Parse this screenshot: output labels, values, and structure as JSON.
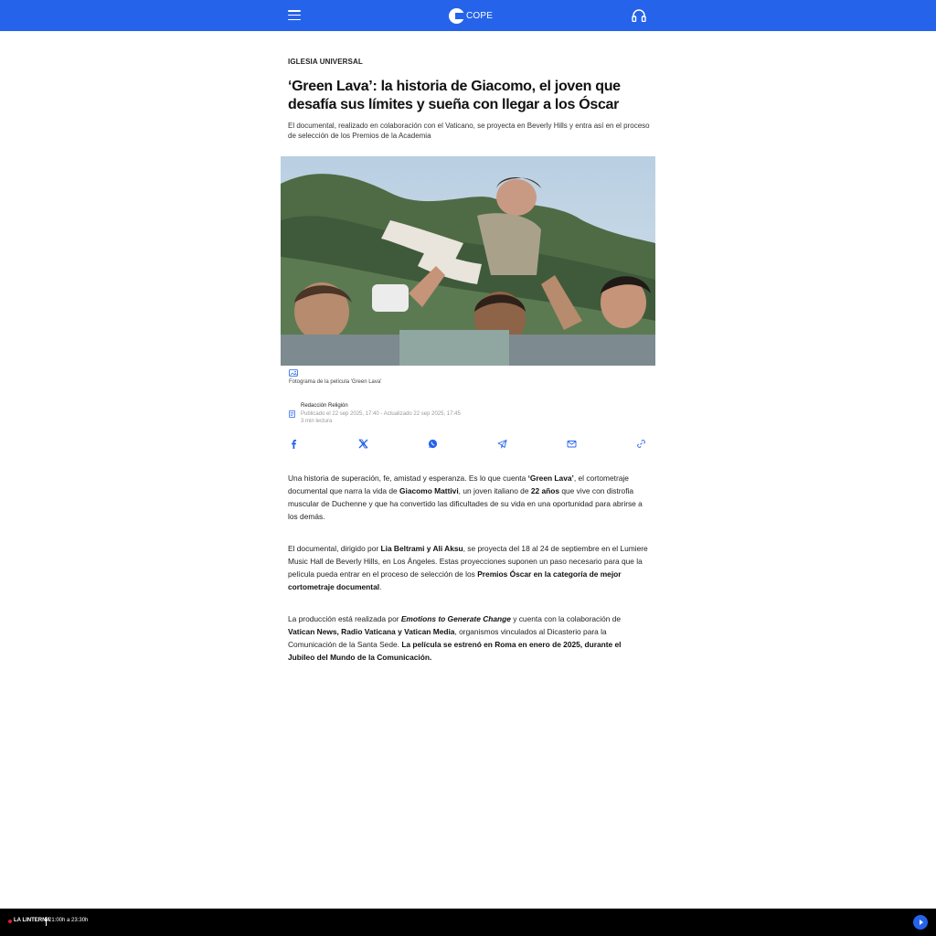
{
  "header": {
    "logo_text": "COPE",
    "menu_icon": "hamburger-menu-icon",
    "listen_icon": "headphones-icon",
    "brand_color": "#2563eb"
  },
  "article": {
    "section": "IGLESIA UNIVERSAL",
    "headline": "‘Green Lava’: la historia de Giacomo, el joven que desafía sus límites y sueña con llegar a los Óscar",
    "subtitle": "El documental, realizado en colaboración con el Vaticano, se proyecta en Beverly Hills y entra así en el proceso de selección de los Premios de la Academia",
    "image_caption": "Fotograma de la película 'Green Lava'",
    "author": "Redacción Religión",
    "dates": "Publicado el 22 sep 2025, 17:40 - Actualizado 22 sep 2025, 17:45",
    "read_time": "3 min lectura"
  },
  "share": {
    "icons": [
      "facebook-icon",
      "x-icon",
      "whatsapp-icon",
      "telegram-icon",
      "email-icon",
      "link-icon"
    ]
  },
  "body": {
    "p1": [
      {
        "t": "Una historia de superación, fe, amistad y esperanza. Es lo que cuenta ",
        "b": false
      },
      {
        "t": "‘Green Lava’",
        "b": true
      },
      {
        "t": ", el cortometraje documental que narra la vida de ",
        "b": false
      },
      {
        "t": "Giacomo Mattivi",
        "b": true
      },
      {
        "t": ", un joven italiano de ",
        "b": false
      },
      {
        "t": "22 años",
        "b": true
      },
      {
        "t": " que vive con distrofia muscular de Duchenne y que ha convertido las dificultades de su vida en una oportunidad para abrirse a los demás.",
        "b": false
      }
    ],
    "p2": [
      {
        "t": "El documental, dirigido por ",
        "b": false
      },
      {
        "t": "Lia Beltrami y Ali Aksu",
        "b": true
      },
      {
        "t": ", se proyecta del 18 al 24 de septiembre en el Lumiere Music Hall de Beverly Hills, en Los Ángeles. Estas proyecciones suponen un paso necesario para que la película pueda entrar en el proceso de selección de los ",
        "b": false
      },
      {
        "t": "Premios Óscar en la categoría de mejor cortometraje documental",
        "b": true
      },
      {
        "t": ".",
        "b": false
      }
    ],
    "p3": [
      {
        "t": "La producción está realizada por ",
        "b": false
      },
      {
        "t": "Emotions to Generate Change",
        "b": true,
        "i": true
      },
      {
        "t": " y cuenta con la colaboración de ",
        "b": false
      },
      {
        "t": "Vatican News, Radio Vaticana y Vatican Media",
        "b": true
      },
      {
        "t": ", organismos vinculados al Dicasterio para la Comunicación de la Santa Sede. ",
        "b": false
      },
      {
        "t": "La película se estrenó en Roma en enero de 2025, durante el Jubileo del Mundo de la Comunicación.",
        "b": true
      }
    ]
  },
  "footer": {
    "program": "LA LINTERNA",
    "schedule": "21:00h a 23:30h",
    "live_color": "#e11d2e",
    "play_icon": "play-icon"
  }
}
